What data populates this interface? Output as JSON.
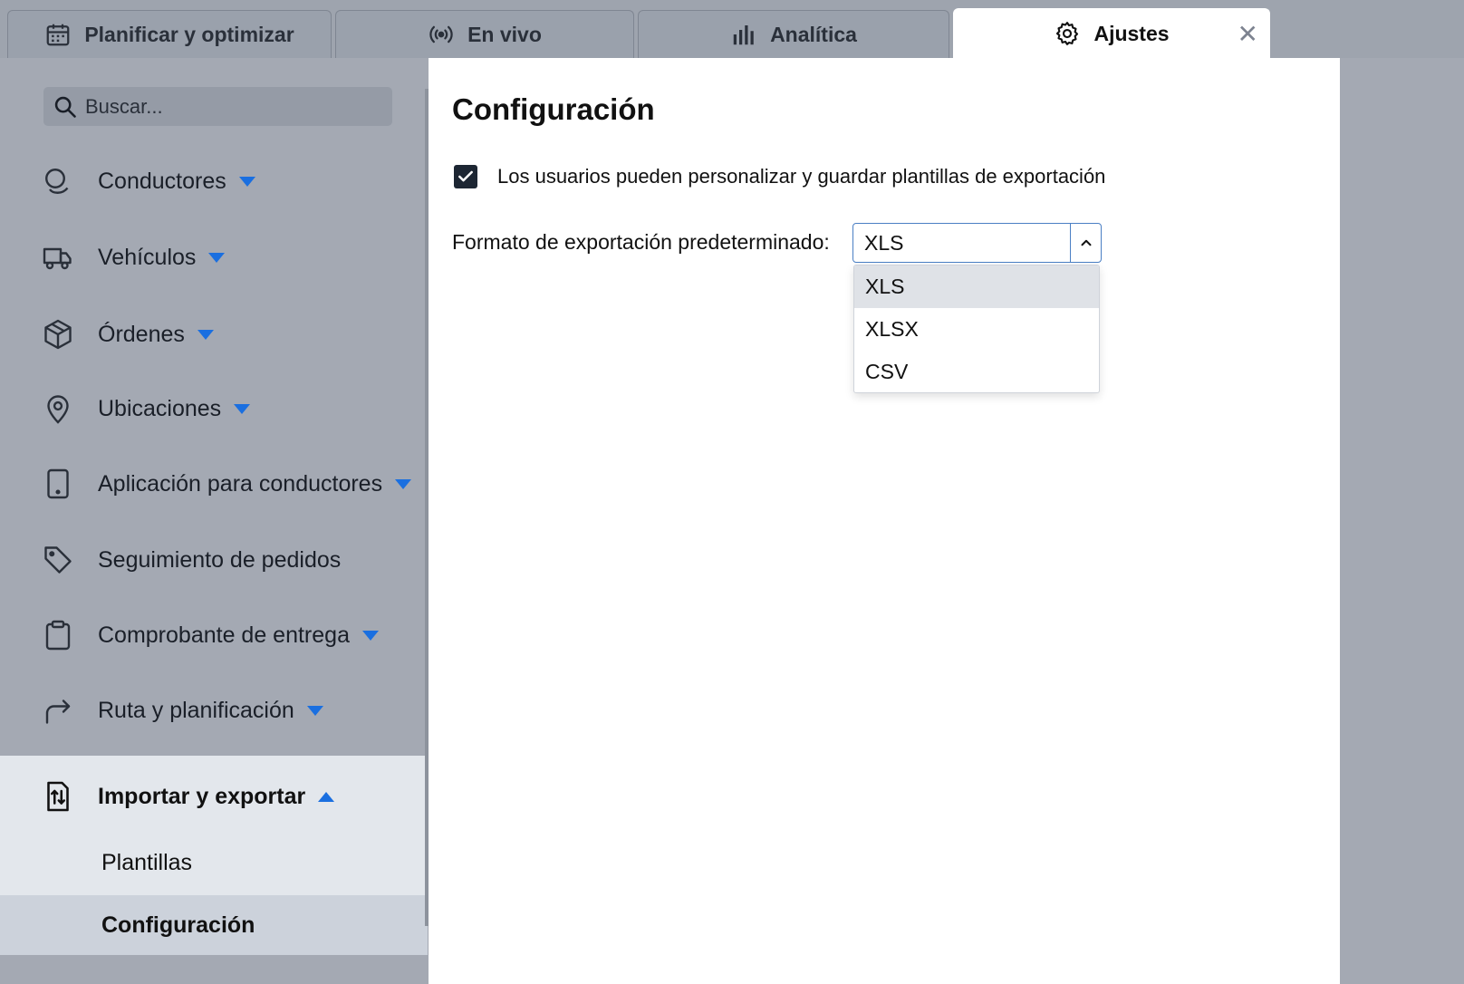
{
  "tabs": [
    {
      "label": "Planificar y optimizar",
      "icon": "calendar-icon",
      "active": false
    },
    {
      "label": "En vivo",
      "icon": "broadcast-icon",
      "active": false
    },
    {
      "label": "Analítica",
      "icon": "bar-chart-icon",
      "active": false
    },
    {
      "label": "Ajustes",
      "icon": "gear-icon",
      "active": true
    }
  ],
  "tab_close": "✕",
  "sidebar": {
    "search_placeholder": "Buscar...",
    "items": [
      {
        "label": "Conductores",
        "icon": "driver-icon",
        "caret": "down"
      },
      {
        "label": "Vehículos",
        "icon": "truck-icon",
        "caret": "down"
      },
      {
        "label": "Órdenes",
        "icon": "box-icon",
        "caret": "down"
      },
      {
        "label": "Ubicaciones",
        "icon": "location-pin-icon",
        "caret": "down"
      },
      {
        "label": "Aplicación para conductores",
        "icon": "phone-icon",
        "caret": "down"
      },
      {
        "label": "Seguimiento de pedidos",
        "icon": "tag-icon",
        "caret": null
      },
      {
        "label": "Comprobante de entrega",
        "icon": "clipboard-icon",
        "caret": "down"
      },
      {
        "label": "Ruta y planificación",
        "icon": "route-arrow-icon",
        "caret": "down"
      }
    ],
    "expanded": {
      "label": "Importar y exportar",
      "icon": "import-export-icon",
      "caret": "up",
      "children": [
        {
          "label": "Plantillas",
          "selected": false
        },
        {
          "label": "Configuración",
          "selected": true
        }
      ]
    }
  },
  "main": {
    "title": "Configuración",
    "checkbox_label": "Los usuarios pueden personalizar y guardar plantillas de exportación",
    "checkbox_checked": true,
    "format_label": "Formato de exportación predeterminado:",
    "format_value": "XLS",
    "format_options": [
      "XLS",
      "XLSX",
      "CSV"
    ],
    "highlighted_option": "XLS"
  },
  "colors": {
    "accent_caret": "#1a6fe0",
    "select_border": "#4a7fc4",
    "sidebar_bg": "#a4a9b3",
    "selected_bg": "#ccd2db"
  }
}
